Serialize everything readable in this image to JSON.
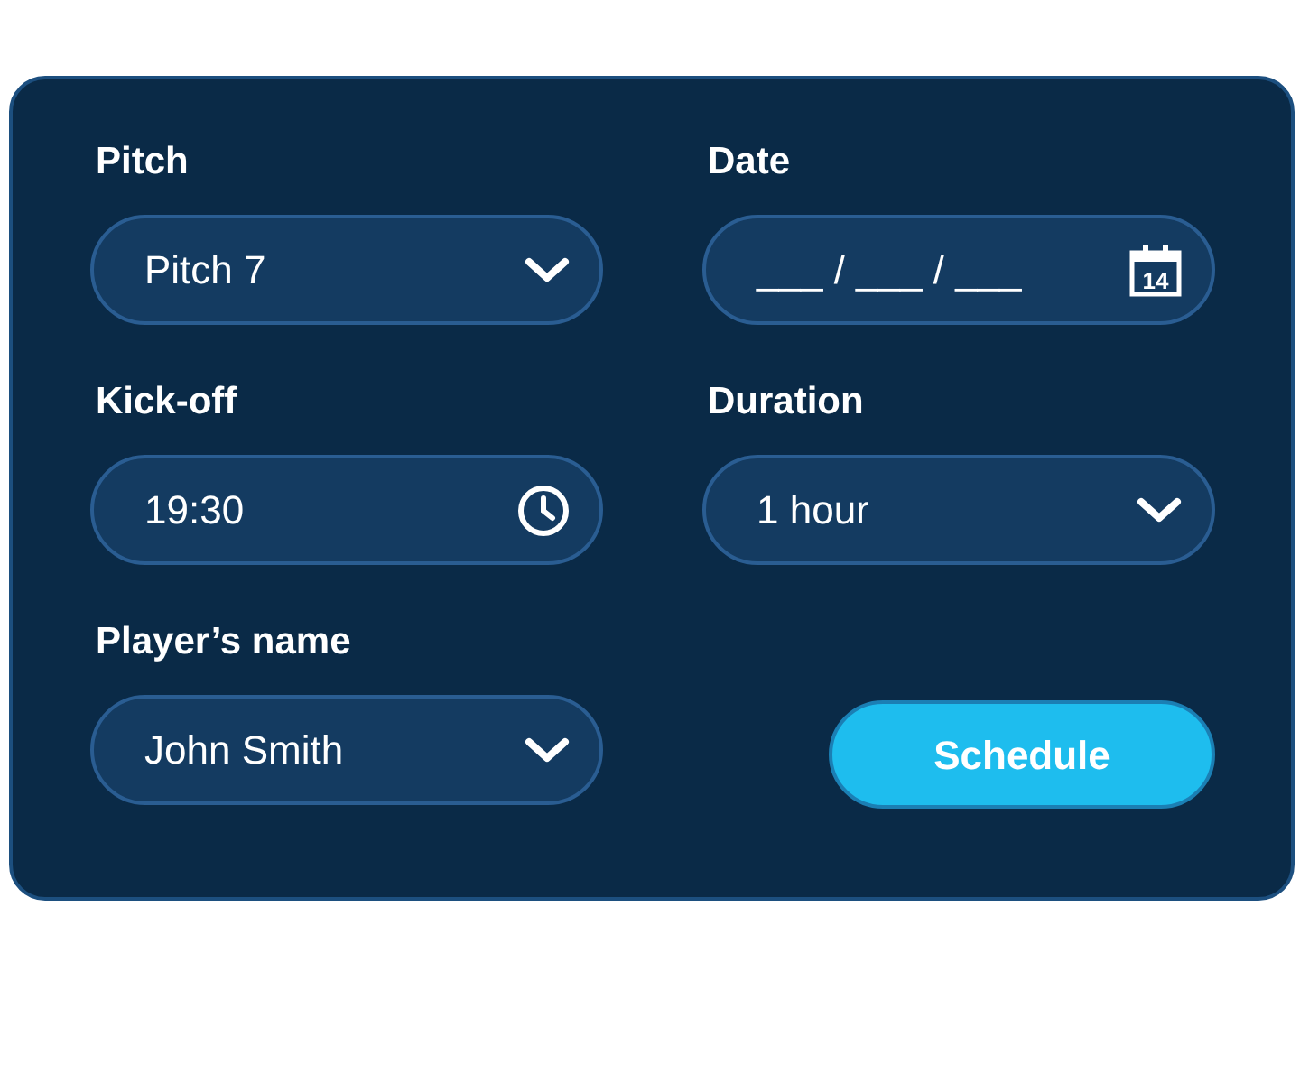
{
  "fields": [
    {
      "label": "Pitch",
      "kind": "select",
      "value": "Pitch 7"
    },
    {
      "label": "Date",
      "kind": "date",
      "placeholder": "___ / ___ / ___",
      "icon_day": "14"
    },
    {
      "label": "Kick-off",
      "kind": "time",
      "value": "19:30"
    },
    {
      "label": "Duration",
      "kind": "select",
      "value": "1 hour"
    },
    {
      "label": "Player’s name",
      "kind": "select",
      "value": "John Smith"
    }
  ],
  "button": "Schedule"
}
